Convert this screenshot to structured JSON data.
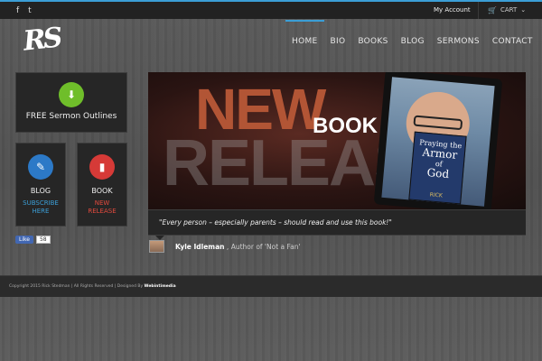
{
  "topbar": {
    "social": [
      {
        "icon": "facebook-icon",
        "glyph": "f"
      },
      {
        "icon": "twitter-icon",
        "glyph": "t"
      }
    ],
    "account_label": "My Account",
    "cart_label": "CART",
    "cart_glyph": "🛒",
    "chevron_glyph": "⌄"
  },
  "header": {
    "logo_text": "RS",
    "nav": [
      "HOME",
      "BIO",
      "BOOKS",
      "BLOG",
      "SERMONS",
      "CONTACT"
    ],
    "active_nav": "HOME"
  },
  "widgets": {
    "sermon": {
      "label": "FREE Sermon Outlines",
      "glyph": "⬇"
    },
    "blog": {
      "title": "BLOG",
      "link_line1": "SUBSCRIBE",
      "link_line2": "HERE",
      "glyph": "✎"
    },
    "book": {
      "title": "BOOK",
      "link_line1": "NEW",
      "link_line2": "RELEASE",
      "glyph": "▮"
    }
  },
  "facebook": {
    "like_label": "Like",
    "count": "58"
  },
  "banner": {
    "word_new": "NEW",
    "word_book": "BOOK",
    "word_release": "RELEASE",
    "cover_line1": "Praying",
    "cover_line2": "the",
    "cover_line3": "Armor",
    "cover_line4": "of",
    "cover_line5": "God",
    "cover_author": "RICK"
  },
  "testimonial": {
    "quote": "\"Every person – especially parents – should read and use this book!\"",
    "author_name": "Kyle Idleman",
    "author_suffix": ", Author of 'Not a Fan'"
  },
  "footer": {
    "copyright": "Copyright 2015 Rick Stedman | All Rights Reserved | Designed By",
    "designer": "Webintimedia"
  },
  "colors": {
    "accent_blue": "#3b9ed6",
    "green": "#6fbe2a",
    "blue": "#2c79c7",
    "red": "#d63a37"
  }
}
